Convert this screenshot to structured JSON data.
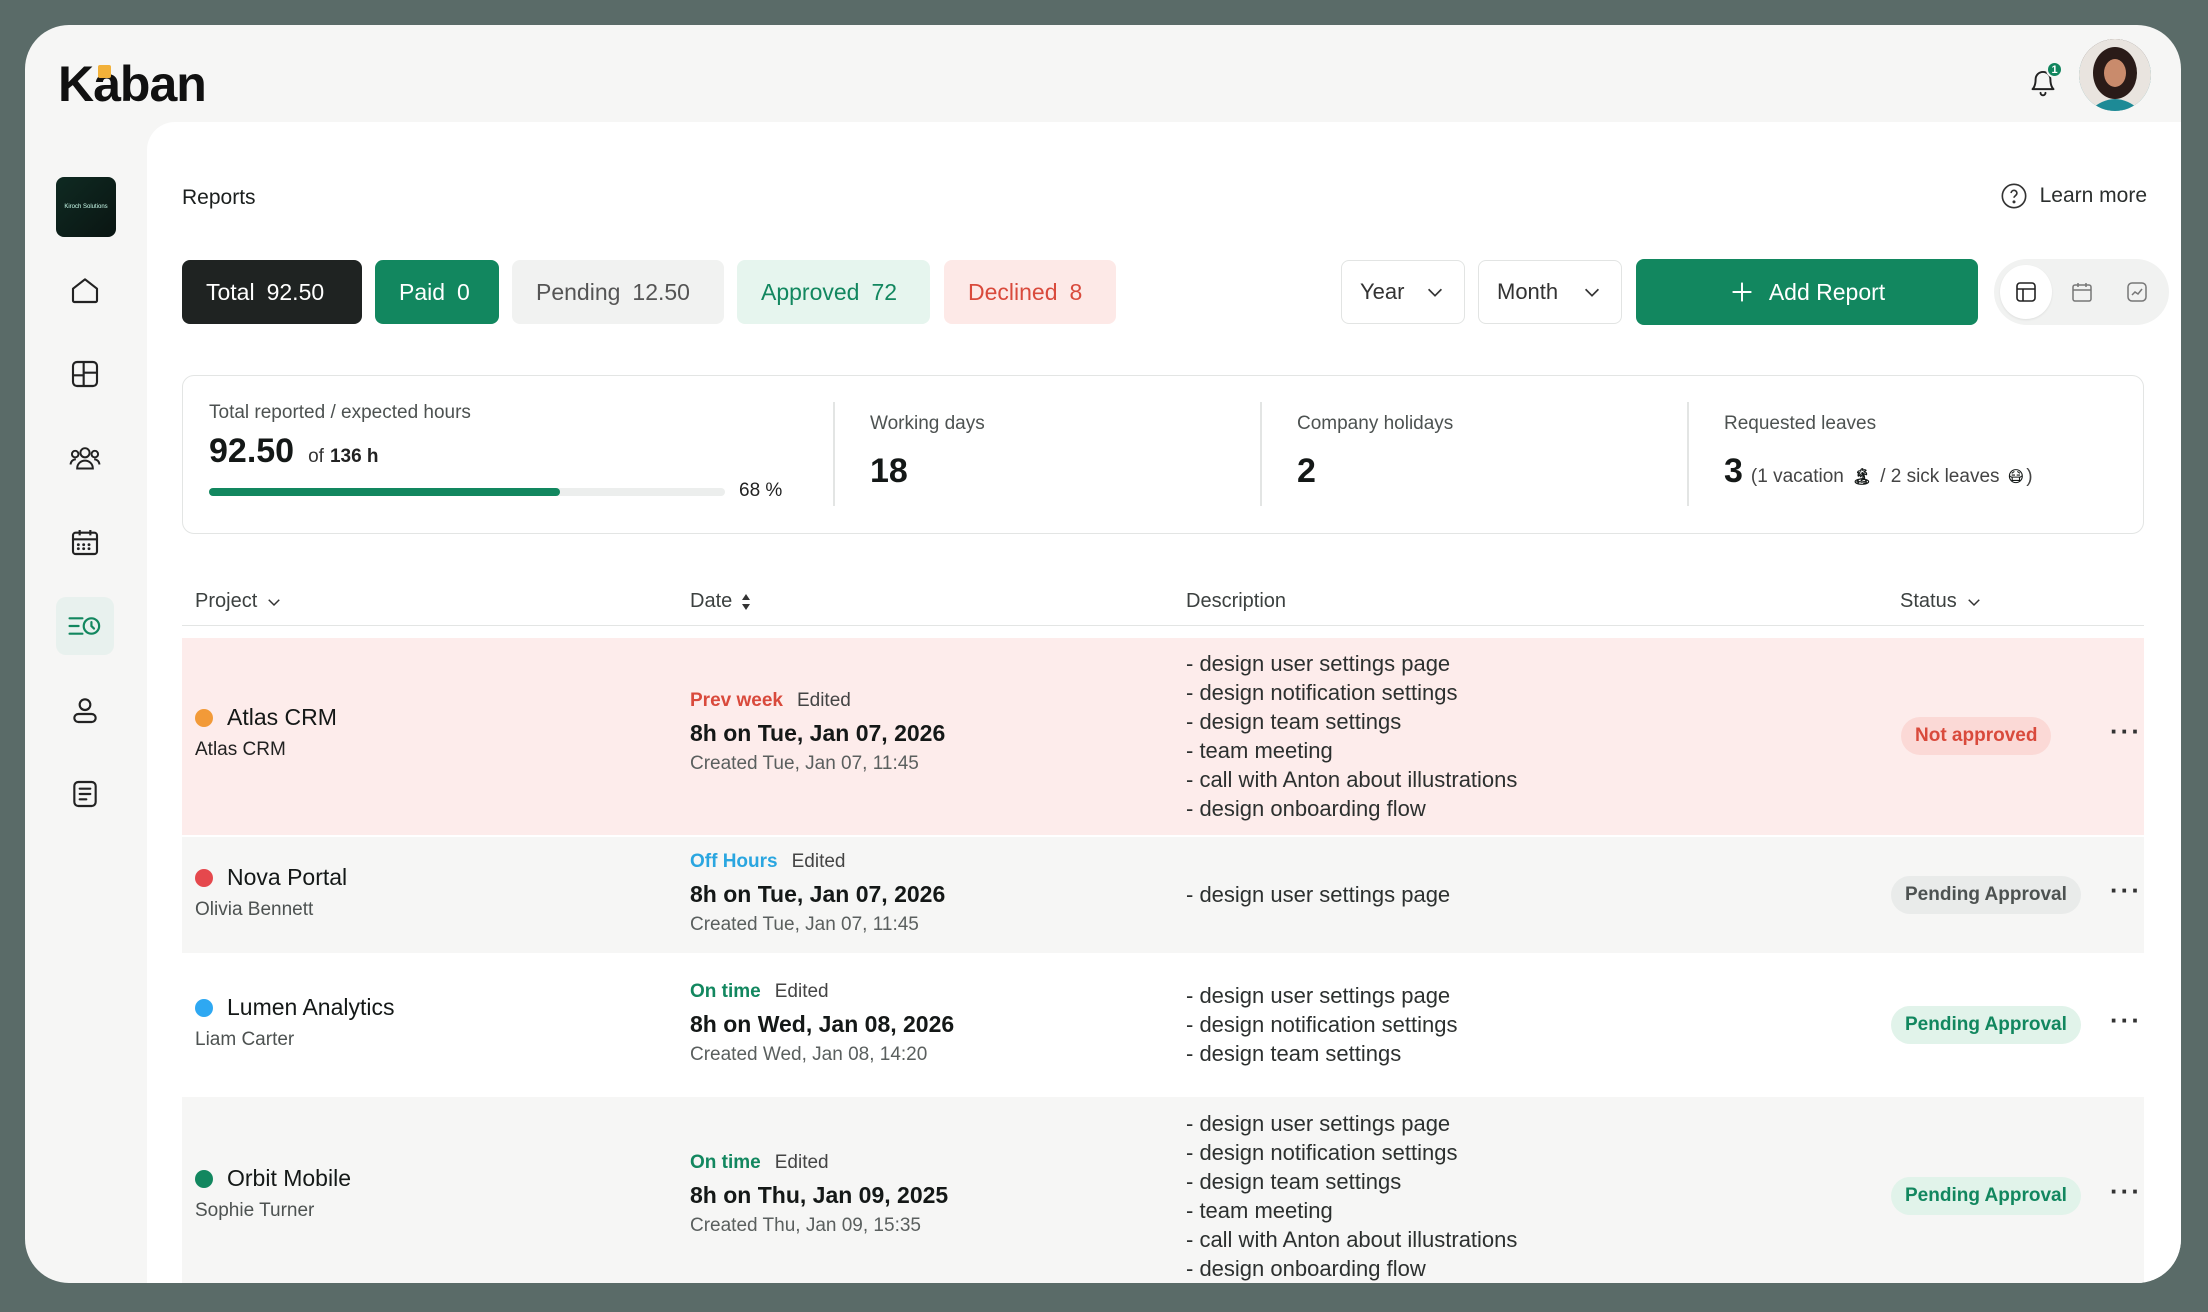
{
  "app": {
    "logo_text_1": "K",
    "logo_text_2": "ban",
    "notification_count": "1"
  },
  "sidebar": {
    "brand_caption": "Kiroch Solutions",
    "items": [
      {
        "name": "home-icon"
      },
      {
        "name": "dashboard-icon"
      },
      {
        "name": "team-icon"
      },
      {
        "name": "calendar-icon"
      },
      {
        "name": "reports-icon"
      },
      {
        "name": "profile-icon"
      },
      {
        "name": "document-icon"
      }
    ]
  },
  "header": {
    "title": "Reports",
    "learn_more": "Learn more"
  },
  "filters": {
    "total_label": "Total",
    "total_value": "92.50",
    "paid_label": "Paid",
    "paid_value": "0",
    "pending_label": "Pending",
    "pending_value": "12.50",
    "approved_label": "Approved",
    "approved_value": "72",
    "declined_label": "Declined",
    "declined_value": "8",
    "year": "Year",
    "month": "Month",
    "add_report": "Add Report"
  },
  "stats": {
    "hours_label": "Total reported / expected hours",
    "hours_value": "92.50",
    "hours_of": "of",
    "hours_expected": "136 h",
    "progress_percent": 68,
    "progress_text": "68 %",
    "working_days_label": "Working days",
    "working_days_value": "18",
    "holidays_label": "Company holidays",
    "holidays_value": "2",
    "leaves_label": "Requested leaves",
    "leaves_value": "3",
    "leaves_detail_1": "(1 vacation",
    "leaves_detail_2": "/ 2 sick leaves",
    "leaves_detail_3": ")"
  },
  "table": {
    "headers": {
      "project": "Project",
      "date": "Date",
      "description": "Description",
      "status": "Status"
    },
    "rows": [
      {
        "project": "Atlas CRM",
        "owner": "Atlas CRM",
        "dot_color": "#f29a38",
        "timing": "Prev week",
        "timing_color": "#d94a3c",
        "edited": "Edited",
        "date": "8h on Tue, Jan 07, 2026",
        "created": "Created Tue, Jan 07, 11:45",
        "description": [
          "- design user settings page",
          "- design notification settings",
          "- design team settings",
          "- team meeting",
          "- call with Anton about illustrations",
          "- design onboarding flow"
        ],
        "status": "Not approved"
      },
      {
        "project": "Nova Portal",
        "owner": "Olivia Bennett",
        "dot_color": "#e5484d",
        "timing": "Off Hours",
        "timing_color": "#2aa6e0",
        "edited": "Edited",
        "date": "8h on Tue, Jan 07, 2026",
        "created": "Created Tue, Jan 07, 11:45",
        "description": [
          "- design user settings page"
        ],
        "status": "Pending Approval"
      },
      {
        "project": "Lumen Analytics",
        "owner": "Liam Carter",
        "dot_color": "#2ea8f2",
        "timing": "On time",
        "timing_color": "#12875f",
        "edited": "Edited",
        "date": "8h on Wed, Jan 08, 2026",
        "created": "Created Wed, Jan 08, 14:20",
        "description": [
          "- design user settings page",
          "- design notification settings",
          "- design team settings"
        ],
        "status": "Pending Approval"
      },
      {
        "project": "Orbit Mobile",
        "owner": "Sophie Turner",
        "dot_color": "#12875f",
        "timing": "On time",
        "timing_color": "#12875f",
        "edited": "Edited",
        "date": "8h on Thu, Jan 09, 2025",
        "created": "Created Thu, Jan 09, 15:35",
        "description": [
          "- design user settings page",
          "- design notification settings",
          "- design team settings",
          "- team meeting",
          "- call with Anton about illustrations",
          "- design onboarding flow"
        ],
        "status": "Pending Approval"
      }
    ]
  }
}
